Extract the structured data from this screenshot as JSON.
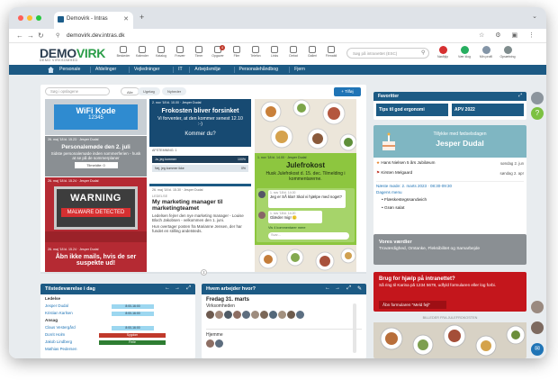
{
  "browser": {
    "tab_title": "Demovirk - Intras",
    "url": "demovirk.dev.intras.dk",
    "traffic_colors": [
      "#ff5f57",
      "#febc2e",
      "#28c840"
    ]
  },
  "header": {
    "logo_a": "DEMO",
    "logo_b": "VIRK",
    "logo_sub": "DEMO VIRKSOMHED",
    "tools": [
      {
        "label": "Beskeder",
        "icon": "mail-icon"
      },
      {
        "label": "Kalender",
        "icon": "calendar-icon"
      },
      {
        "label": "Katalog",
        "icon": "catalog-icon"
      },
      {
        "label": "Fravær",
        "icon": "absence-icon"
      },
      {
        "label": "Timer",
        "icon": "clock-icon"
      },
      {
        "label": "Opgaver",
        "icon": "tasks-icon",
        "badge": "4"
      },
      {
        "label": "Filer",
        "icon": "folder-icon"
      },
      {
        "label": "Telefon",
        "icon": "phone-icon"
      },
      {
        "label": "Links",
        "icon": "link-icon"
      },
      {
        "label": "Debat",
        "icon": "chat-icon"
      },
      {
        "label": "Galleri",
        "icon": "gallery-icon"
      },
      {
        "label": "Firmabil",
        "icon": "car-icon"
      }
    ],
    "search_placeholder": "Søg på intranettet (ESC)",
    "right": [
      {
        "label": "Nødhjlp",
        "color": "#d63031"
      },
      {
        "label": "Vær klog",
        "color": "#27ae60"
      },
      {
        "label": "Min profil",
        "color": "#8395a7"
      },
      {
        "label": "Opsætning",
        "color": "#7f8c8d"
      }
    ]
  },
  "nav": {
    "items": [
      "Personale",
      "Afdelinger",
      "Vejledninger",
      "IT",
      "Arbejdsmiljø",
      "Personalehåndbog",
      "Fjern"
    ]
  },
  "board": {
    "search_placeholder": "Søg i opslagene",
    "filters": [
      "Alle",
      "Ugeløg",
      "Nyheder"
    ],
    "add_label": "+ Tilføj",
    "col1": {
      "wifi_title": "WiFi Kode",
      "wifi_code": "12345",
      "meta2": "26. maj '18 kl. 15.23 · Jesper Dudal",
      "meeting_title": "Personalemøde den 2. juli",
      "meeting_text": "Sidste personalemøde inden sommerferien - husk at se på de sommerplaner",
      "meeting_btn": "Tilmeldte: 0",
      "meta3": "26. maj '18 kl. 15.24 · Jesper Dudal",
      "warning_big": "WARNING",
      "warning_small": "MALWARE DETECTED",
      "meta4": "26. maj '18 kl. 15.24 · Jesper Dudal",
      "mail_title": "Åbn ikke mails, hvis de ser suspekte ud!"
    },
    "col2": {
      "meta1": "2. nov '18 kl. 10.00 · Jesper Dudal",
      "meeting_title": "Frokosten bliver forsinket",
      "meeting_text": "Vi forventer, at den kommer senest 12.10 :-)",
      "question": "Kommer du?",
      "stats_label": "AFSTEMNING: 1",
      "stats": [
        {
          "label": "Ja, jeg kommer",
          "value": "100%",
          "pct": 100,
          "color": "#1f3f5a"
        },
        {
          "label": "Nej, jeg kommer ikke",
          "value": "0%",
          "pct": 0,
          "color": "#1f3f5a"
        }
      ],
      "meta2": "26. maj '18 kl. 15.30 · Jesper Dudal",
      "tag": "LEDELSE",
      "mgr_title": "My marketing manager til marketingteamet",
      "mgr_text": "Ledelsen fejrer den nye marketing manager - Louise Bloch Jakobsen - velkommen den 1. juni.",
      "mgr_text2": "Hun overtager posten fra Marianne Jensen, der har fundet en stilling andetsteds."
    },
    "col3": {
      "meta1": "1. nov '18 kl. 14.00 · Jesper Dudal",
      "julefrokost_title": "Julefrokost",
      "julefrokost_text": "Husk Julefrokost d. 15. dec. Tilmelding i kommentarerne.",
      "comments": [
        {
          "meta": "1. nov '18 kl. 14.00",
          "text": "Jeg er SÅ klar! Skal vi hjælpe med noget?"
        },
        {
          "meta": "1. nov '18 kl. 14.20",
          "text": "Glæder mig! 🙂"
        }
      ],
      "more": "Vis 4 kommentarer mere",
      "reply": "Svar..."
    }
  },
  "attendance": {
    "title": "Tilstedeværelse i dag",
    "hours": [
      "08",
      "10",
      "12",
      "14",
      "16"
    ],
    "groups": [
      {
        "name": "Ledelse",
        "rows": [
          {
            "name": "Jesper Dudal",
            "bar_label": "8:00-16:00",
            "color": "#9cd7f0",
            "start": 0.18,
            "len": 0.45
          },
          {
            "name": "Kristian Karlsen",
            "bar_label": "8:00-16:00",
            "color": "#9cd7f0",
            "start": 0.18,
            "len": 0.45
          }
        ]
      },
      {
        "name": "Ansag",
        "rows": [
          {
            "name": "Claus Vestergård",
            "bar_label": "8:00-16:00",
            "color": "#9cd7f0",
            "start": 0.18,
            "len": 0.45
          },
          {
            "name": "Dorrit Holm",
            "bar_label": "Sygdom",
            "color": "#c0392b",
            "start": 0.05,
            "len": 0.7
          },
          {
            "name": "Jakob Lindberg",
            "bar_label": "Ferie",
            "color": "#2e7d32",
            "start": 0.05,
            "len": 0.7
          },
          {
            "name": "Mathias Pedersen",
            "bar_label": "",
            "color": "#ffffff",
            "start": 0,
            "len": 0
          }
        ]
      }
    ]
  },
  "where": {
    "title": "Hvem arbejder hvor?",
    "date": "Fredag 31. marts",
    "place1": "Virksomheden",
    "place2": "Hjemme"
  },
  "favorites": {
    "title": "Favoritter",
    "items": [
      {
        "label": "Tips til god ergonomi"
      },
      {
        "label": "APV 2022"
      }
    ]
  },
  "birthday": {
    "greeting": "Tillykke med fødselsdagen",
    "name": "Jesper Dudal",
    "rows": [
      {
        "name": "Hans Nielsen 5 års Jubilæum",
        "date": "søndag 2. jun"
      },
      {
        "name": "Kirsten Melgaard",
        "date": "søndag 2. apr"
      }
    ],
    "next_meeting": "Næste møde: 2. marts 2023 · 08:30-09:30",
    "menu_title": "Dagens menu",
    "menu_items": [
      "Flæskestegssandwich",
      "Grøn salat"
    ]
  },
  "values": {
    "title": "Vores værdier",
    "text": "Troværdighed, Omtanke, Fleksibilitet og Samarbejde"
  },
  "help": {
    "title": "Brug for hjælp på intranettet?",
    "text": "Så ring til Karina på 1234 5678, udfyld formularen eller log forbi.",
    "button": "Åbn formularen \"Meld fejl\""
  },
  "gallery": {
    "label": "BILLEDER FRA JULEFROKOSTEN"
  }
}
